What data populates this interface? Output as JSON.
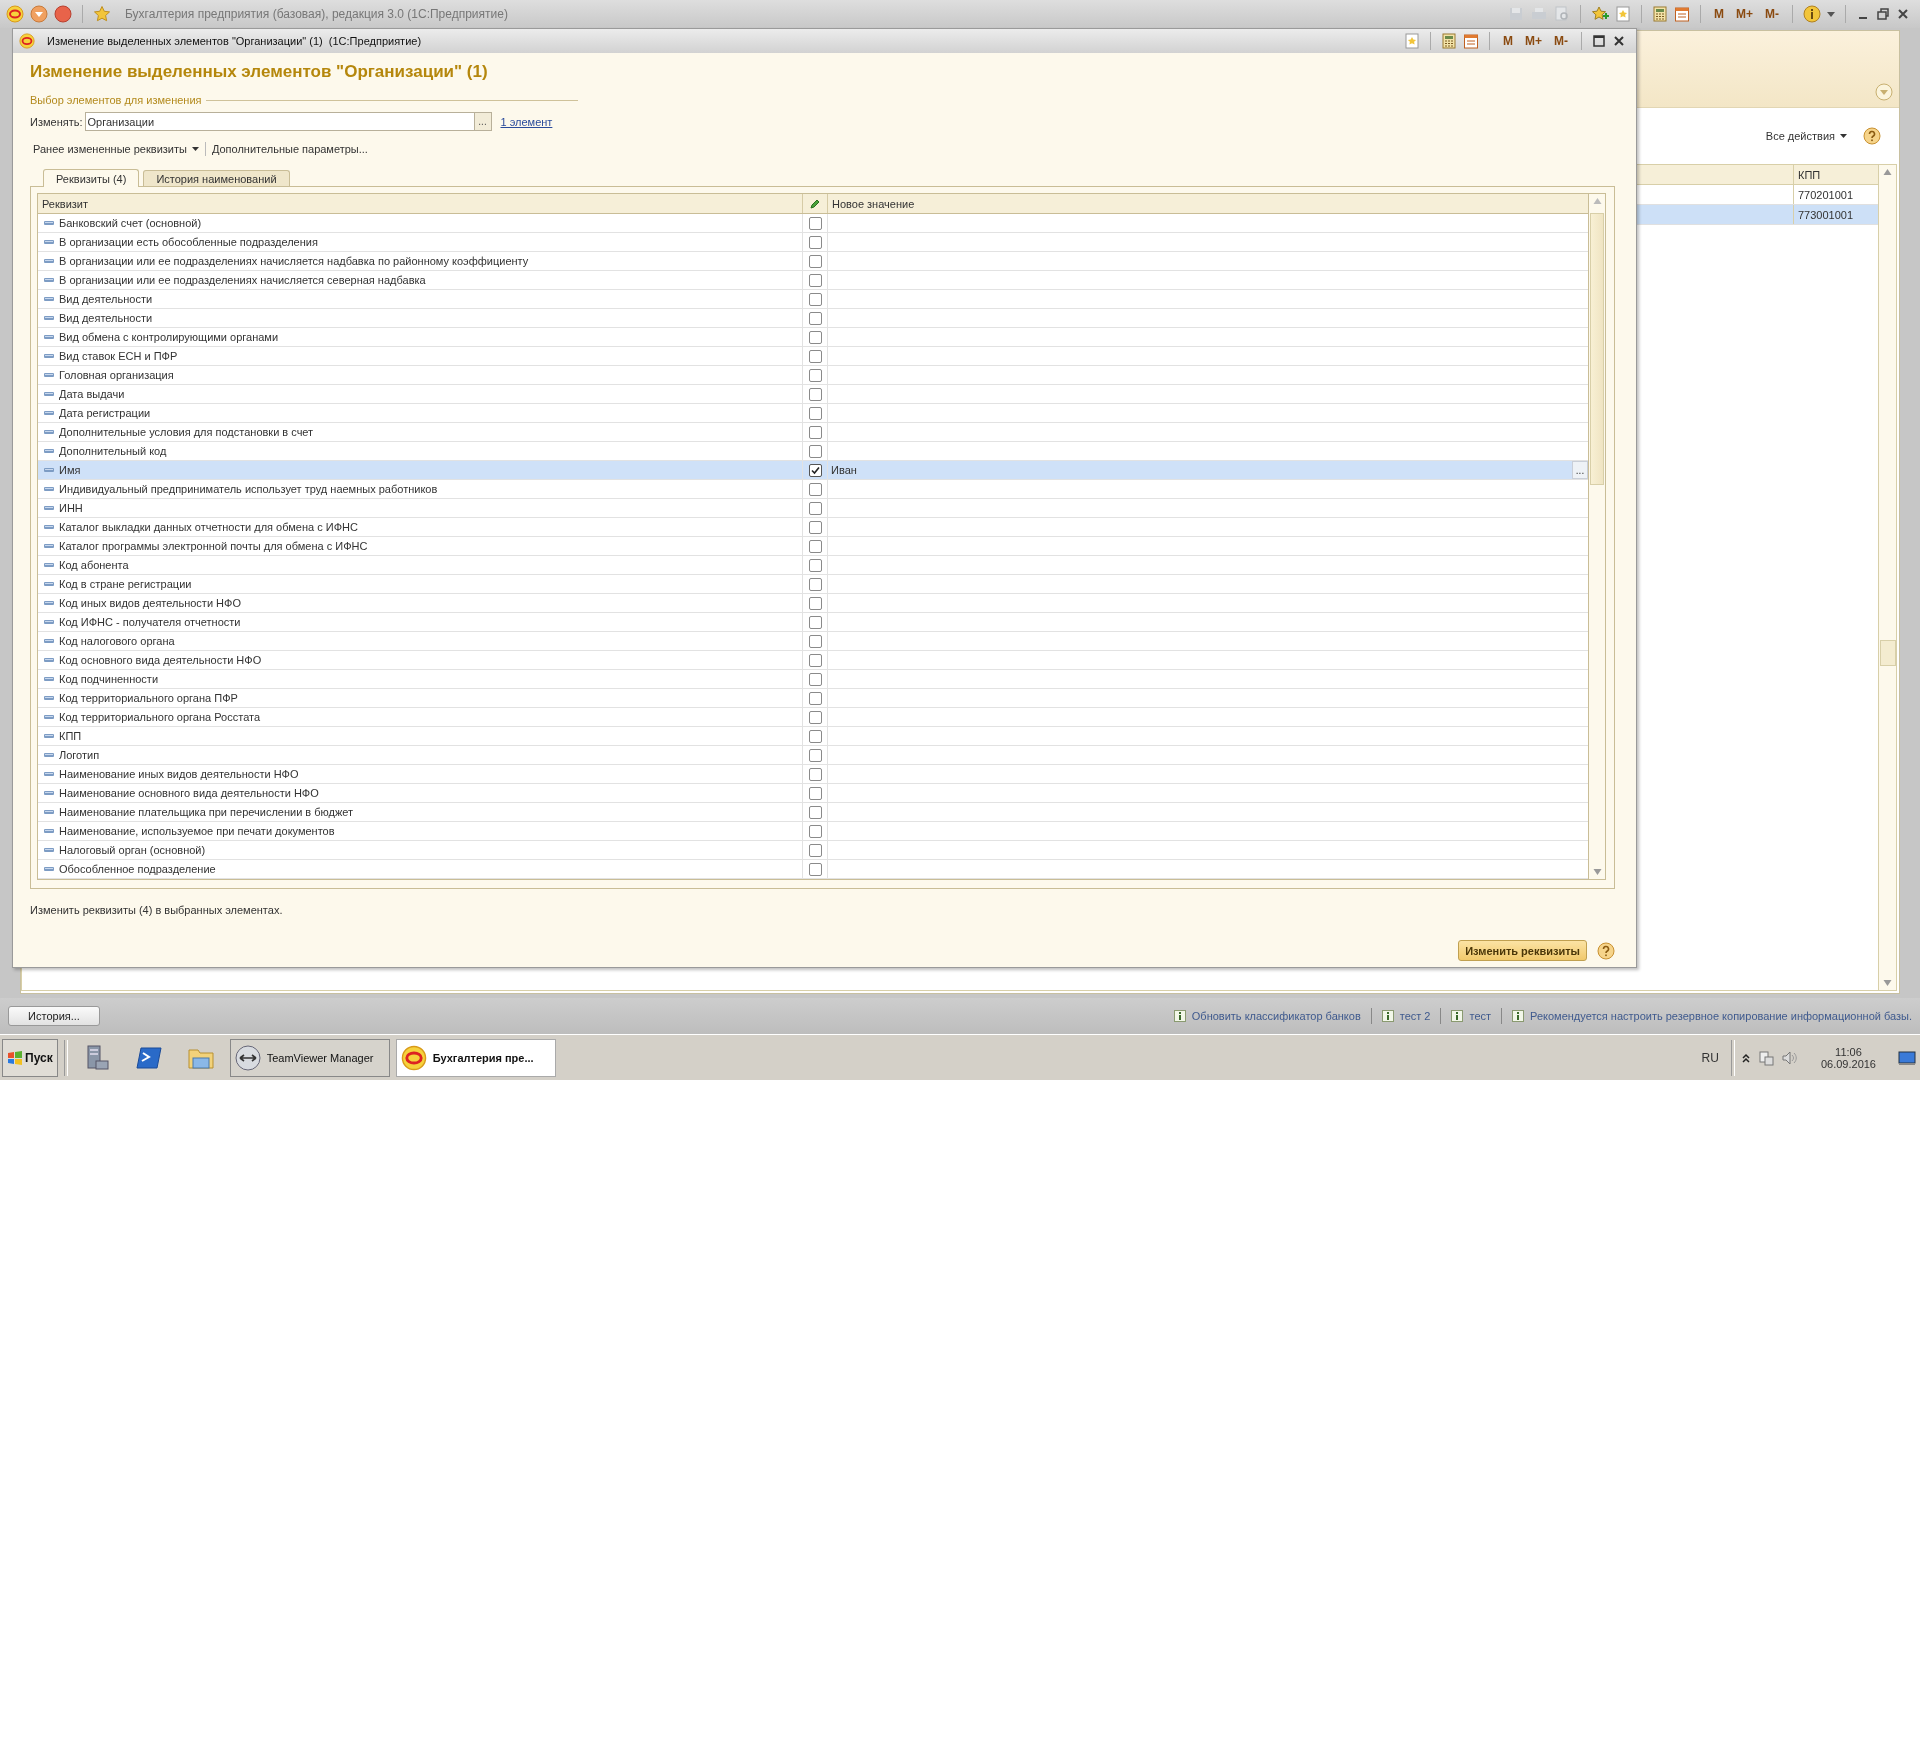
{
  "main_window": {
    "title": "Бухгалтерия предприятия (базовая), редакция 3.0 (1С:Предприятие)",
    "memory_buttons": [
      "M",
      "M+",
      "M-"
    ],
    "actions_menu": "Все действия",
    "kpp_table": {
      "column": "КПП",
      "rows": [
        {
          "value": "770201001",
          "selected": false
        },
        {
          "value": "773001001",
          "selected": true
        }
      ]
    },
    "history_button": "История...",
    "notifications": [
      "Обновить классификатор банков",
      "тест 2",
      "тест",
      "Рекомендуется настроить резервное копирование информационной базы."
    ]
  },
  "dialog": {
    "title": "Изменение выделенных элементов \"Организации\" (1)  (1С:Предприятие)",
    "memory_buttons": [
      "M",
      "M+",
      "M-"
    ],
    "heading": "Изменение выделенных элементов \"Организации\" (1)",
    "group_label": "Выбор элементов для изменения",
    "field_label": "Изменять:",
    "field_value": "Организации",
    "field_button": "...",
    "link": "1 элемент",
    "toolbar": [
      {
        "label": "Ранее измененные реквизиты",
        "kind": "menu"
      },
      {
        "label": "Дополнительные параметры...",
        "kind": "button"
      }
    ],
    "tabs": [
      {
        "label": "Реквизиты (4)",
        "selected": true
      },
      {
        "label": "История наименований",
        "selected": false
      }
    ],
    "table": {
      "columns": [
        "Реквизит",
        "Новое значение"
      ],
      "rows": [
        {
          "name": "Банковский счет (основной)",
          "checked": false,
          "selected": false
        },
        {
          "name": "В организации есть обособленные подразделения",
          "checked": false,
          "selected": false
        },
        {
          "name": "В организации или ее подразделениях начисляется надбавка по районному коэффициенту",
          "checked": false,
          "selected": false
        },
        {
          "name": "В организации или ее подразделениях начисляется северная надбавка",
          "checked": false,
          "selected": false
        },
        {
          "name": "Вид деятельности",
          "checked": false,
          "selected": false
        },
        {
          "name": "Вид деятельности",
          "checked": false,
          "selected": false
        },
        {
          "name": "Вид обмена с контролирующими органами",
          "checked": false,
          "selected": false
        },
        {
          "name": "Вид ставок ЕСН и ПФР",
          "checked": false,
          "selected": false
        },
        {
          "name": "Головная организация",
          "checked": false,
          "selected": false
        },
        {
          "name": "Дата выдачи",
          "checked": false,
          "selected": false
        },
        {
          "name": "Дата регистрации",
          "checked": false,
          "selected": false
        },
        {
          "name": "Дополнительные условия для подстановки в счет",
          "checked": false,
          "selected": false
        },
        {
          "name": "Дополнительный код",
          "checked": false,
          "selected": false
        },
        {
          "name": "Имя",
          "checked": true,
          "selected": true,
          "value": "Иван",
          "button": "..."
        },
        {
          "name": "Индивидуальный предприниматель использует труд наемных работников",
          "checked": false,
          "selected": false
        },
        {
          "name": "ИНН",
          "checked": false,
          "selected": false
        },
        {
          "name": "Каталог выкладки данных отчетности для обмена с ИФНС",
          "checked": false,
          "selected": false
        },
        {
          "name": "Каталог программы электронной почты для обмена с ИФНС",
          "checked": false,
          "selected": false
        },
        {
          "name": "Код абонента",
          "checked": false,
          "selected": false
        },
        {
          "name": "Код в стране регистрации",
          "checked": false,
          "selected": false
        },
        {
          "name": "Код иных видов деятельности НФО",
          "checked": false,
          "selected": false
        },
        {
          "name": "Код ИФНС - получателя отчетности",
          "checked": false,
          "selected": false
        },
        {
          "name": "Код налогового органа",
          "checked": false,
          "selected": false
        },
        {
          "name": "Код основного вида деятельности НФО",
          "checked": false,
          "selected": false
        },
        {
          "name": "Код подчиненности",
          "checked": false,
          "selected": false
        },
        {
          "name": "Код территориального органа ПФР",
          "checked": false,
          "selected": false
        },
        {
          "name": "Код территориального органа Росстата",
          "checked": false,
          "selected": false
        },
        {
          "name": "КПП",
          "checked": false,
          "selected": false
        },
        {
          "name": "Логотип",
          "checked": false,
          "selected": false
        },
        {
          "name": "Наименование иных видов деятельности НФО",
          "checked": false,
          "selected": false
        },
        {
          "name": "Наименование основного вида деятельности НФО",
          "checked": false,
          "selected": false
        },
        {
          "name": "Наименование плательщика при перечислении в бюджет",
          "checked": false,
          "selected": false
        },
        {
          "name": "Наименование, используемое при печати документов",
          "checked": false,
          "selected": false
        },
        {
          "name": "Налоговый орган (основной)",
          "checked": false,
          "selected": false
        },
        {
          "name": "Обособленное подразделение",
          "checked": false,
          "selected": false
        }
      ]
    },
    "footer": "Изменить реквизиты (4) в выбранных элементах.",
    "submit": "Изменить реквизиты"
  },
  "taskbar": {
    "start": "Пуск",
    "tasks": [
      {
        "label": "TeamViewer Manager",
        "kind": "teamviewer",
        "selected": false
      },
      {
        "label": "Бухгалтерия пре...",
        "kind": "onec",
        "selected": true
      }
    ],
    "language": "RU",
    "time": "11:06",
    "date": "06.09.2016"
  }
}
